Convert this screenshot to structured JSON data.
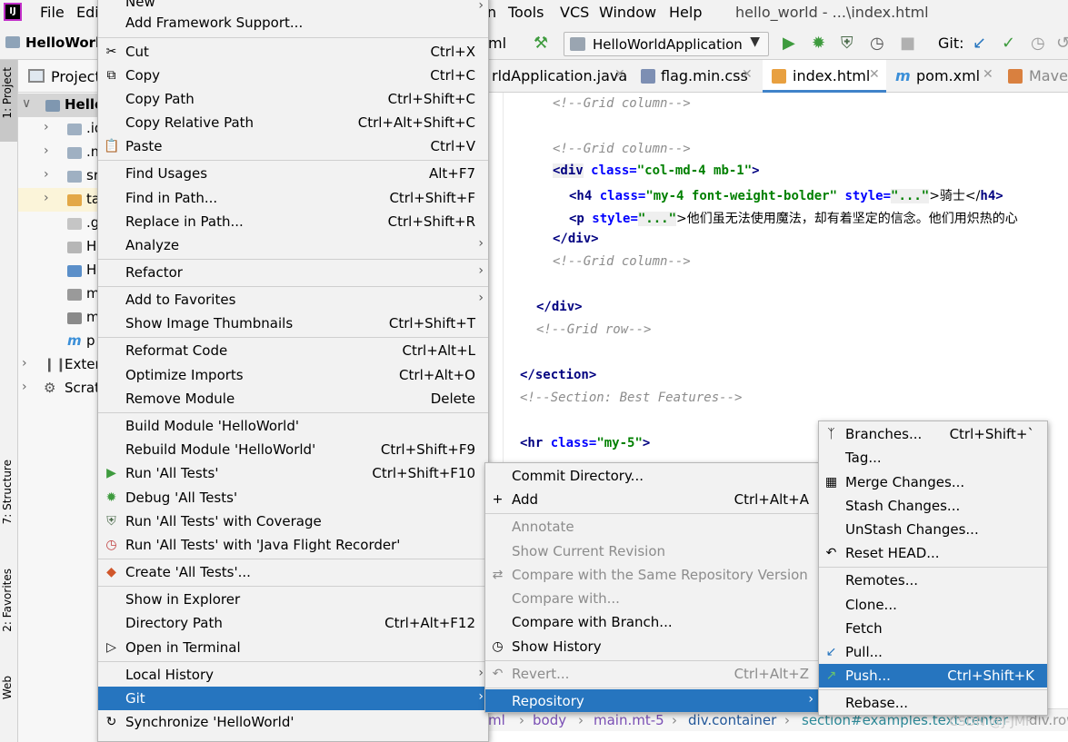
{
  "window": {
    "title": "hello_world - ...\\index.html",
    "menubar": [
      "File",
      "Edi",
      "n",
      "Tools",
      "VCS",
      "Window",
      "Help"
    ],
    "logo": "IJ"
  },
  "toolbar": {
    "project_name": "HelloWorld",
    "partial_label": "ml",
    "run_config": "HelloWorldApplication",
    "git_label": "Git:"
  },
  "left_strip": {
    "project": "1: Project",
    "structure": "7: Structure",
    "favorites": "2: Favorites",
    "web": "Web"
  },
  "project_panel": {
    "header": "Project",
    "root": "Hello",
    "rows": [
      ".id",
      ".m",
      "sr",
      "ta",
      ".g",
      "H",
      "H",
      "m",
      "m",
      "p"
    ],
    "external": "Exter",
    "scratches": "Scrat"
  },
  "tabs": [
    {
      "label": "rldApplication.java",
      "active": false
    },
    {
      "label": "flag.min.css",
      "active": false
    },
    {
      "label": "index.html",
      "active": true
    },
    {
      "label": "pom.xml",
      "active": false
    },
    {
      "label": "Maven",
      "active": false
    }
  ],
  "editor": {
    "lines": {
      "c1": "<!--Grid column-->",
      "c2": "<!--Grid column-->",
      "div_open": "<div",
      "div_attr": "class=",
      "div_val": "\"col-md-4 mb-1\"",
      "div_close": ">",
      "h4_open": "<h4",
      "h4_attr1": "class=",
      "h4_val1": "\"my-4 font-weight-bolder\"",
      "h4_attr2": "style=",
      "h4_val2": "\"...\"",
      "h4_text": ">骑士</",
      "h4_end": "h4>",
      "p_open": "<p",
      "p_attr": "style=",
      "p_val": "\"...\"",
      "p_text": ">他们虽无法使用魔法，却有着坚定的信念。他们用炽热的心",
      "div_end": "</div>",
      "c3": "<!--Grid column-->",
      "div_end2": "</div>",
      "c4": "<!--Grid row-->",
      "section_end": "</section>",
      "c5": "<!--Section: Best Features-->",
      "hr_open": "<hr",
      "hr_attr": "class=",
      "hr_val": "\"my-5\"",
      "hr_close": ">"
    }
  },
  "breadcrumbs": [
    "ml",
    "body",
    "main.mt-5",
    "div.container",
    "section#examples.text-center",
    "div.row"
  ],
  "watermark": "CSDN @J-JMF",
  "context_menu": {
    "new_label": "New",
    "add_framework": "Add Framework Support...",
    "cut": {
      "label": "Cut",
      "shortcut": "Ctrl+X"
    },
    "copy": {
      "label": "Copy",
      "shortcut": "Ctrl+C"
    },
    "copy_path": {
      "label": "Copy Path",
      "shortcut": "Ctrl+Shift+C"
    },
    "copy_relative_path": {
      "label": "Copy Relative Path",
      "shortcut": "Ctrl+Alt+Shift+C"
    },
    "paste": {
      "label": "Paste",
      "shortcut": "Ctrl+V"
    },
    "find_usages": {
      "label": "Find Usages",
      "shortcut": "Alt+F7"
    },
    "find_in_path": {
      "label": "Find in Path...",
      "shortcut": "Ctrl+Shift+F"
    },
    "replace_in_path": {
      "label": "Replace in Path...",
      "shortcut": "Ctrl+Shift+R"
    },
    "analyze": "Analyze",
    "refactor": "Refactor",
    "add_to_favorites": "Add to Favorites",
    "show_thumbnails": {
      "label": "Show Image Thumbnails",
      "shortcut": "Ctrl+Shift+T"
    },
    "reformat_code": {
      "label": "Reformat Code",
      "shortcut": "Ctrl+Alt+L"
    },
    "optimize_imports": {
      "label": "Optimize Imports",
      "shortcut": "Ctrl+Alt+O"
    },
    "remove_module": {
      "label": "Remove Module",
      "shortcut": "Delete"
    },
    "build_module": "Build Module 'HelloWorld'",
    "rebuild_module": {
      "label": "Rebuild Module 'HelloWorld'",
      "shortcut": "Ctrl+Shift+F9"
    },
    "run_all_tests": {
      "label": "Run 'All Tests'",
      "shortcut": "Ctrl+Shift+F10"
    },
    "debug_all_tests": "Debug 'All Tests'",
    "run_coverage": "Run 'All Tests' with Coverage",
    "run_jfr": "Run 'All Tests' with 'Java Flight Recorder'",
    "create_all_tests": "Create 'All Tests'...",
    "show_in_explorer": "Show in Explorer",
    "directory_path": {
      "label": "Directory Path",
      "shortcut": "Ctrl+Alt+F12"
    },
    "open_terminal": "Open in Terminal",
    "local_history": "Local History",
    "git": "Git",
    "synchronize": "Synchronize 'HelloWorld'"
  },
  "git_menu": {
    "commit_directory": "Commit Directory...",
    "add": {
      "label": "Add",
      "shortcut": "Ctrl+Alt+A"
    },
    "annotate": "Annotate",
    "show_current_revision": "Show Current Revision",
    "compare_same_repo": "Compare with the Same Repository Version",
    "compare_with": "Compare with...",
    "compare_branch": "Compare with Branch...",
    "show_history": "Show History",
    "revert": {
      "label": "Revert...",
      "shortcut": "Ctrl+Alt+Z"
    },
    "repository": "Repository"
  },
  "repository_menu": {
    "branches": {
      "label": "Branches...",
      "shortcut": "Ctrl+Shift+`"
    },
    "tag": "Tag...",
    "merge_changes": "Merge Changes...",
    "stash_changes": "Stash Changes...",
    "unstash_changes": "UnStash Changes...",
    "reset_head": "Reset HEAD...",
    "remotes": "Remotes...",
    "clone": "Clone...",
    "fetch": "Fetch",
    "pull": "Pull...",
    "push": {
      "label": "Push...",
      "shortcut": "Ctrl+Shift+K"
    },
    "rebase": "Rebase..."
  },
  "colors": {
    "highlight": "#2675bf",
    "menu_bg": "#f2f2f2",
    "tag": "#000080",
    "attr": "#0000ff",
    "value": "#008000",
    "comment": "#8c8c8c"
  }
}
